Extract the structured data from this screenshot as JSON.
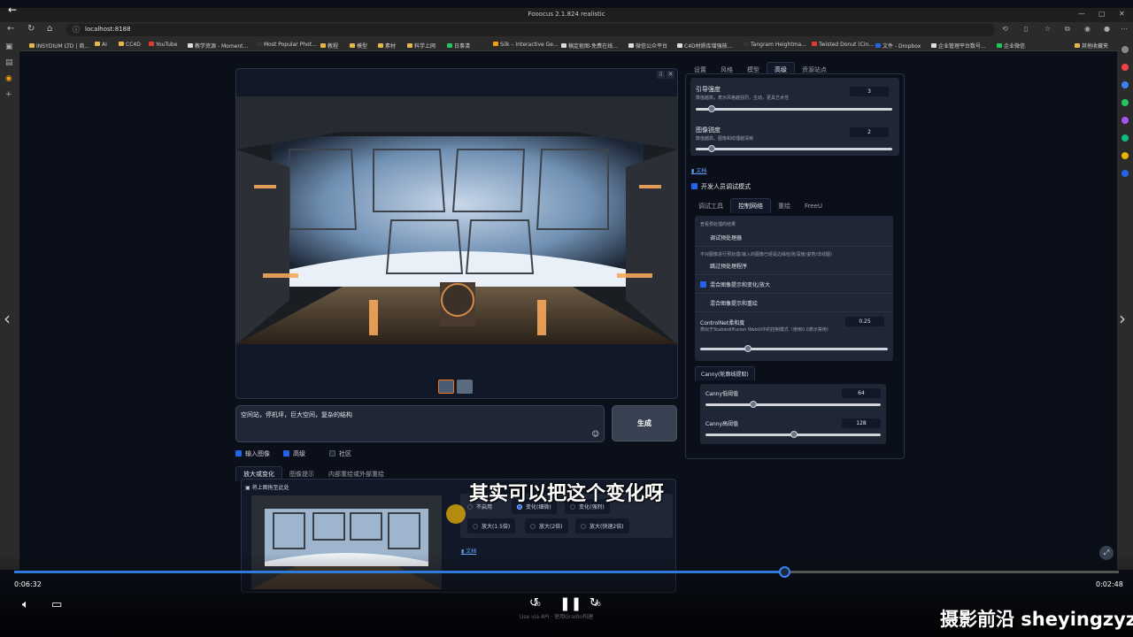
{
  "browser": {
    "window_title": "Fooocus 2.1.824 realistic",
    "url": "localhost:8188",
    "bookmarks": [
      "INSYDIUM LTD | 商...",
      "AI",
      "CC4D",
      "YouTube",
      "教学资源 - Moment...",
      "Most Popular Phot...",
      "教程",
      "模型",
      "素材",
      "科学上网",
      "日事清",
      "Silk – Interactive Ge...",
      "稿定抠图-免费在线...",
      "微信公众平台",
      "C4D材质库增强核...",
      "Tangram Heightma...",
      "Twisted Donut (Cin...",
      "文件 - Dropbox",
      "企业管理平台数号...",
      "企业微信",
      "其他收藏夹"
    ]
  },
  "gallery": {
    "prompt_text": "空间站，停机坪，巨大空间，复杂的结构",
    "generate_label": "生成"
  },
  "options": {
    "input_image": "输入图像",
    "advanced": "高级",
    "community": "社区"
  },
  "image_tabs": [
    "放大或变化",
    "图像提示",
    "内部重绘或外部重绘"
  ],
  "upscale": {
    "drop_label": "将上图拖至此处",
    "radios": [
      "不启用",
      "变化(细微)",
      "变化(强烈)",
      "放大(1.5倍)",
      "放大(2倍)",
      "放大(快速2倍)"
    ],
    "selected": "变化(细微)",
    "doc_link": "文档"
  },
  "right_tabs": [
    "设置",
    "风格",
    "模型",
    "高级",
    "资源站点"
  ],
  "sliders": {
    "guidance_label": "引导强度",
    "guidance_desc": "数值越高，表示风格越强烈，生动，更具艺术性",
    "guidance_value": "3",
    "sharpness_label": "图像锐度",
    "sharpness_desc": "数值越高，图像和纹理越清晰",
    "sharpness_value": "2"
  },
  "doc_link": "文档",
  "dev_mode_label": "开发人员调试模式",
  "debug_tabs": [
    "调试工具",
    "控制网络",
    "重绘",
    "FreeU"
  ],
  "debug": {
    "hint1": "查看预处理的结果",
    "debug_preprocessor": "调试预处理器",
    "hint2": "不对图像进行预处理(输入的图像已经是边缘检测/深度/姿势/法线图)",
    "skip_preprocessor": "跳过预处理程序",
    "mix_prompt_vary": "混合图像提示和变化/放大",
    "mix_prompt_inpaint": "混合图像提示和重绘",
    "softness_label": "ControlNet柔和度",
    "softness_desc": "类似于Stablediffusion WebUI中的控制模式（使用0.0表示禁用）",
    "softness_value": "0.25"
  },
  "canny": {
    "tab_label": "Canny(轮廓线提取)",
    "low_label": "Canny低阈值",
    "low_value": "64",
    "high_label": "Canny高阈值",
    "high_value": "128"
  },
  "player": {
    "subtitle": "其实可以把这个变化呀",
    "current_time": "0:06:32",
    "total_time": "0:02:48",
    "progress_fraction": 0.697,
    "skip_back": "10",
    "skip_forward": "30",
    "api_hint": "Use via API  ·  使用Gradio构建"
  },
  "watermark": "摄影前沿 sheyingzyz.com"
}
